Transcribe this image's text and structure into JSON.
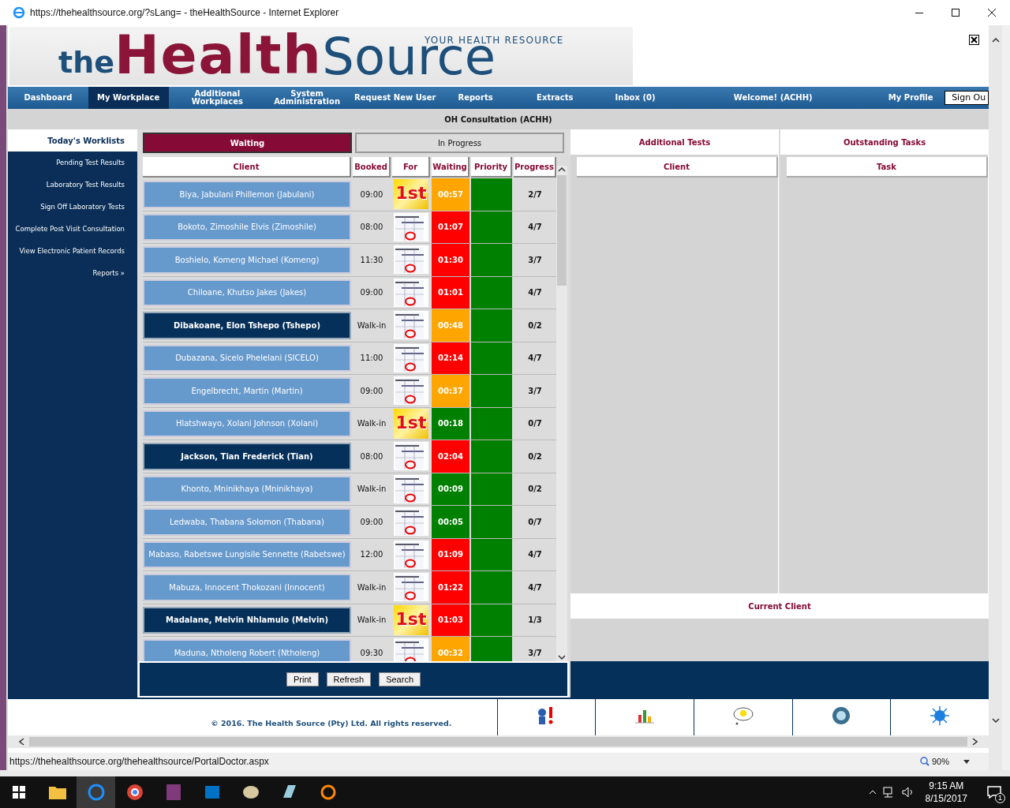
{
  "window": {
    "title": "https://thehealthsource.org/?sLang= - theHealthSource - Internet Explorer"
  },
  "logo": {
    "word_1": "the",
    "word_2": "Health",
    "word_3": "Source",
    "tagline": "YOUR HEALTH RESOURCE"
  },
  "nav": [
    {
      "label": "Dashboard",
      "selected": false
    },
    {
      "label": "My Workplace",
      "selected": true
    },
    {
      "label": "Additional Workplaces",
      "selected": false
    },
    {
      "label": "System Administration",
      "selected": false
    },
    {
      "label": "Request New User",
      "selected": false
    },
    {
      "label": "Reports",
      "selected": false
    },
    {
      "label": "Extracts",
      "selected": false
    },
    {
      "label": "Inbox (0)",
      "selected": false
    },
    {
      "label": "Welcome! (ACHH)",
      "selected": false
    },
    {
      "label": "My Profile",
      "selected": false
    }
  ],
  "sign_out": "Sign Ou",
  "page_title": "OH Consultation (ACHH)",
  "sidebar": {
    "heading": "Today's Worklists",
    "items": [
      "Pending Test Results",
      "Laboratory Test Results",
      "Sign Off Laboratory Tests",
      "Complete Post Visit Consultation",
      "View Electronic Patient Records",
      "Reports »"
    ]
  },
  "worklist_tabs": [
    {
      "label": "Waiting",
      "selected": true
    },
    {
      "label": "In Progress",
      "selected": false
    }
  ],
  "table": {
    "columns": [
      "Client",
      "Booked",
      "For",
      "Waiting",
      "Priority",
      "Progress"
    ],
    "rows": [
      {
        "client": "Biya, Jabulani Phillemon (Jabulani)",
        "highlighted": false,
        "booked": "09:00",
        "for": {
          "kind": "first",
          "label": "1st"
        },
        "waiting": {
          "text": "00:57",
          "color": "#ffa500"
        },
        "priority": {
          "color": "#008000"
        },
        "progress": "2/7"
      },
      {
        "client": "Bokoto, Zimoshile Elvis (Zimoshile)",
        "highlighted": false,
        "booked": "08:00",
        "for": {
          "kind": "calendar"
        },
        "waiting": {
          "text": "01:07",
          "color": "#ff0000"
        },
        "priority": {
          "color": "#008000"
        },
        "progress": "4/7"
      },
      {
        "client": "Boshielo, Komeng Michael (Komeng)",
        "highlighted": false,
        "booked": "11:30",
        "for": {
          "kind": "calendar"
        },
        "waiting": {
          "text": "01:30",
          "color": "#ff0000"
        },
        "priority": {
          "color": "#008000"
        },
        "progress": "3/7"
      },
      {
        "client": "Chiloane, Khutso Jakes (Jakes)",
        "highlighted": false,
        "booked": "09:00",
        "for": {
          "kind": "calendar"
        },
        "waiting": {
          "text": "01:01",
          "color": "#ff0000"
        },
        "priority": {
          "color": "#008000"
        },
        "progress": "4/7"
      },
      {
        "client": "Dibakoane, Elon Tshepo (Tshepo)",
        "highlighted": true,
        "booked": "Walk-in",
        "for": {
          "kind": "calendar"
        },
        "waiting": {
          "text": "00:48",
          "color": "#ffa500"
        },
        "priority": {
          "color": "#008000"
        },
        "progress": "0/2"
      },
      {
        "client": "Dubazana, Sicelo Phelelani (SICELO)",
        "highlighted": false,
        "booked": "11:00",
        "for": {
          "kind": "calendar"
        },
        "waiting": {
          "text": "02:14",
          "color": "#ff0000"
        },
        "priority": {
          "color": "#008000"
        },
        "progress": "4/7"
      },
      {
        "client": "Engelbrecht, Martin (Martin)",
        "highlighted": false,
        "booked": "09:00",
        "for": {
          "kind": "calendar"
        },
        "waiting": {
          "text": "00:37",
          "color": "#ffa500"
        },
        "priority": {
          "color": "#008000"
        },
        "progress": "3/7"
      },
      {
        "client": "Hlatshwayo, Xolani Johnson (Xolani)",
        "highlighted": false,
        "booked": "Walk-in",
        "for": {
          "kind": "first",
          "label": "1st"
        },
        "waiting": {
          "text": "00:18",
          "color": "#008000"
        },
        "priority": {
          "color": "#008000"
        },
        "progress": "0/7"
      },
      {
        "client": "Jackson, Tian Frederick (Tian)",
        "highlighted": true,
        "booked": "08:00",
        "for": {
          "kind": "calendar"
        },
        "waiting": {
          "text": "02:04",
          "color": "#ff0000"
        },
        "priority": {
          "color": "#008000"
        },
        "progress": "0/2"
      },
      {
        "client": "Khonto, Mninikhaya (Mninikhaya)",
        "highlighted": false,
        "booked": "Walk-in",
        "for": {
          "kind": "calendar"
        },
        "waiting": {
          "text": "00:09",
          "color": "#008000"
        },
        "priority": {
          "color": "#008000"
        },
        "progress": "0/2"
      },
      {
        "client": "Ledwaba, Thabana Solomon (Thabana)",
        "highlighted": false,
        "booked": "09:00",
        "for": {
          "kind": "calendar"
        },
        "waiting": {
          "text": "00:05",
          "color": "#008000"
        },
        "priority": {
          "color": "#008000"
        },
        "progress": "0/7"
      },
      {
        "client": "Mabaso, Rabetswe Lungisile Sennette (Rabetswe)",
        "highlighted": false,
        "booked": "12:00",
        "for": {
          "kind": "calendar"
        },
        "waiting": {
          "text": "01:09",
          "color": "#ff0000"
        },
        "priority": {
          "color": "#008000"
        },
        "progress": "4/7"
      },
      {
        "client": "Mabuza, Innocent Thokozani (Innocent)",
        "highlighted": false,
        "booked": "Walk-in",
        "for": {
          "kind": "calendar"
        },
        "waiting": {
          "text": "01:22",
          "color": "#ff0000"
        },
        "priority": {
          "color": "#008000"
        },
        "progress": "4/7"
      },
      {
        "client": "Madalane, Melvin Nhlamulo (Melvin)",
        "highlighted": true,
        "booked": "Walk-in",
        "for": {
          "kind": "first",
          "label": "1st"
        },
        "waiting": {
          "text": "01:03",
          "color": "#ff0000"
        },
        "priority": {
          "color": "#008000"
        },
        "progress": "1/3"
      },
      {
        "client": "Maduna, Ntholeng Robert (Ntholeng)",
        "highlighted": false,
        "booked": "09:30",
        "for": {
          "kind": "calendar"
        },
        "waiting": {
          "text": "00:32",
          "color": "#ffa500"
        },
        "priority": {
          "color": "#008000"
        },
        "progress": "3/7"
      }
    ]
  },
  "buttons": [
    "Print",
    "Refresh",
    "Search"
  ],
  "right_tabs": [
    "Additional Tests",
    "Outstanding Tasks"
  ],
  "right_columns": [
    [
      "Client"
    ],
    [
      "Task"
    ]
  ],
  "current_client": "Current Client",
  "footer": {
    "copyright": "© 2016. The Health Source (Pty) Ltd. All rights reserved."
  },
  "status_bar": {
    "url": "https://thehealthsource.org/thehealthsource/PortalDoctor.aspx",
    "zoom": "90%"
  },
  "taskbar": {
    "time": "9:15 AM",
    "date": "8/15/2017",
    "notifications": "1"
  }
}
